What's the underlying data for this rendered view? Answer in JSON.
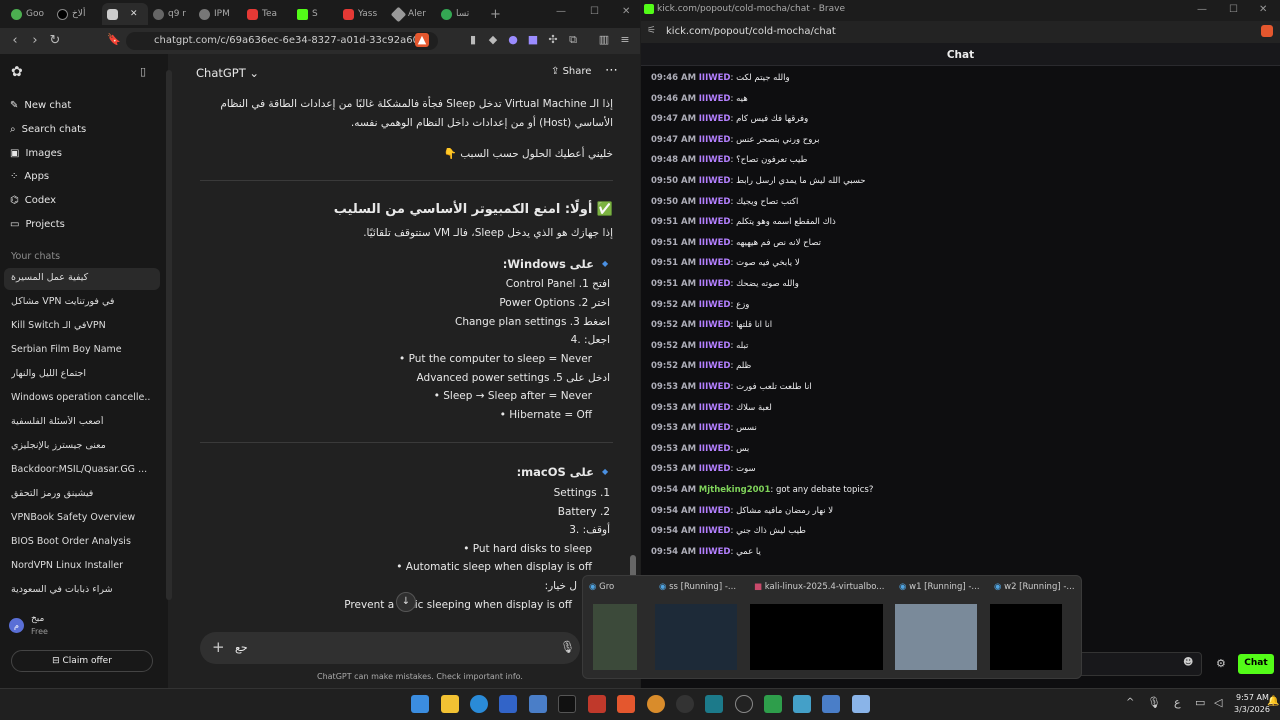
{
  "left_browser": {
    "tabs": [
      "Goo",
      "ألاخ",
      "",
      "q9 r",
      "IPM",
      "Tea",
      "S",
      "Yass",
      "Aler",
      "تسا"
    ],
    "url": "chatgpt.com/c/69a636ec-6e34-8327-a01d-33c92a60..."
  },
  "sidebar": {
    "new_chat": "New chat",
    "search": "Search chats",
    "images": "Images",
    "apps": "Apps",
    "codex": "Codex",
    "projects": "Projects",
    "your_chats": "Your chats",
    "chats": [
      "كيفية عمل المسيرة",
      "مشاكل VPN في فورتنايت",
      "Kill Switch في الـVPN",
      "Serbian Film Boy Name",
      "اجتماع الليل والنهار",
      "Windows operation cancelle...",
      "أصعب الأسئلة الفلسفية",
      "معنى جيسترز بالإنجليزي",
      "Backdoor:MSIL/Quasar.GG ...",
      "فيشينق ورمز التحقق",
      "VPNBook Safety Overview",
      "BIOS Boot Order Analysis",
      "NordVPN Linux Installer",
      "شراء ذبابات في السعودية"
    ],
    "user_name": "مبخ",
    "user_plan": "Free",
    "claim": "Claim offer"
  },
  "main": {
    "model": "ChatGPT",
    "share": "Share",
    "p1a": "إذا الـ Virtual Machine تدخل Sleep فجأة فالمشكلة غالبًا من إعدادات الطاقة في النظام",
    "p1b": "الأساسي (Host) أو من إعدادات داخل النظام الوهمي نفسه.",
    "p2": "خليني أعطيك الحلول حسب السبب 👇",
    "h1": "✅ أولًا: امنع الكمبيوتر الأساسي من السليب",
    "p3": "إذا جهازك هو الذي يدخل Sleep، فالـ VM ستتوقف تلقائيًا.",
    "win_head": "على Windows:",
    "w1": "افتح Control Panel",
    "w2": "اختر Power Options",
    "w3": "اضغط Change plan settings",
    "w4": "اجعل:",
    "w4a": "Put the computer to sleep = Never",
    "w5": "ادخل على Advanced power settings",
    "w5a": "Sleep → Sleep after = Never",
    "w5b": "Hibernate = Off",
    "mac_head": "على macOS:",
    "m1": "Settings",
    "m2": "Battery",
    "m3": "أوقف:",
    "m3a": "Put hard disks to sleep",
    "m3b": "Automatic sleep when display is off",
    "m4": "ل خيار:",
    "m4a": "Prevent a natic sleeping when display is off",
    "composer_text": "حع",
    "footer": "ChatGPT can make mistakes. Check important info."
  },
  "right_browser": {
    "title": "kick.com/popout/cold-mocha/chat - Brave",
    "url": "kick.com/popout/cold-mocha/chat",
    "chat_title": "Chat",
    "send": "Chat",
    "messages": [
      {
        "time": "09:46 AM",
        "user": "IIIWED",
        "text": "والله جيتم لكت"
      },
      {
        "time": "09:46 AM",
        "user": "IIIWED",
        "text": "هيه"
      },
      {
        "time": "09:47 AM",
        "user": "IIIWED",
        "text": "وفرقها فك فيس كام"
      },
      {
        "time": "09:47 AM",
        "user": "IIIWED",
        "text": "بروح ورني بتصحر عنس"
      },
      {
        "time": "09:48 AM",
        "user": "IIIWED",
        "text": "طيب تعرفون تصاح؟"
      },
      {
        "time": "09:50 AM",
        "user": "IIIWED",
        "text": "حسبي الله ليش ما يمدي ارسل رابط"
      },
      {
        "time": "09:50 AM",
        "user": "IIIWED",
        "text": "اكتب تصاح ويجيك"
      },
      {
        "time": "09:51 AM",
        "user": "IIIWED",
        "text": "ذاك المقطع اسمه وهو يتكلم"
      },
      {
        "time": "09:51 AM",
        "user": "IIIWED",
        "text": "تصاح لانه نص فم هيهيهه"
      },
      {
        "time": "09:51 AM",
        "user": "IIIWED",
        "text": "لا يابخي فيه صوت"
      },
      {
        "time": "09:51 AM",
        "user": "IIIWED",
        "text": "والله صوته يضحك"
      },
      {
        "time": "09:52 AM",
        "user": "IIIWED",
        "text": "وزع"
      },
      {
        "time": "09:52 AM",
        "user": "IIIWED",
        "text": "انا انا قلتها"
      },
      {
        "time": "09:52 AM",
        "user": "IIIWED",
        "text": "تبله"
      },
      {
        "time": "09:52 AM",
        "user": "IIIWED",
        "text": "ظلم"
      },
      {
        "time": "09:53 AM",
        "user": "IIIWED",
        "text": "انا طلعت تلعب فورت"
      },
      {
        "time": "09:53 AM",
        "user": "IIIWED",
        "text": "لعبة سلاك"
      },
      {
        "time": "09:53 AM",
        "user": "IIIWED",
        "text": "نسس"
      },
      {
        "time": "09:53 AM",
        "user": "IIIWED",
        "text": "بس"
      },
      {
        "time": "09:53 AM",
        "user": "IIIWED",
        "text": "سوت"
      },
      {
        "time": "09:54 AM",
        "user": "Mjtheking2001",
        "text": "got any debate topics?"
      },
      {
        "time": "09:54 AM",
        "user": "IIIWED",
        "text": "لا نهار رمضان مافيه مشاكل"
      },
      {
        "time": "09:54 AM",
        "user": "IIIWED",
        "text": "طيب ليش ذاك جني"
      },
      {
        "time": "09:54 AM",
        "user": "IIIWED",
        "text": "يا عمي"
      }
    ]
  },
  "taskbar": {
    "thumbs": [
      "Gro",
      "ss [Running] -...",
      "kali-linux-2025.4-virtualbo...",
      "w1 [Running] -...",
      "w2 [Running] -..."
    ],
    "time": "9:57 AM",
    "date": "3/3/2026",
    "lang": "ع"
  },
  "colors": {
    "chatgpt_bg": "#212121",
    "sidebar_bg": "#181818",
    "kick_bg": "#0e0e10",
    "user_purple": "#b480ff",
    "user_green": "#7fd35a"
  }
}
